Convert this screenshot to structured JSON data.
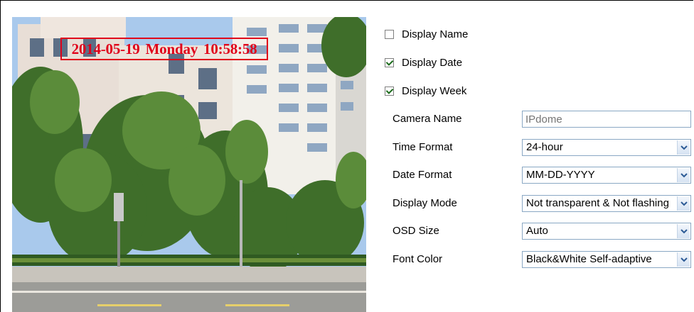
{
  "preview": {
    "osd_date": "2014-05-19",
    "osd_week": "Monday",
    "osd_time": "10:58:58"
  },
  "checkboxes": [
    {
      "label": "Display Name",
      "checked": false
    },
    {
      "label": "Display Date",
      "checked": true
    },
    {
      "label": "Display Week",
      "checked": true
    }
  ],
  "fields": {
    "camera_name": {
      "label": "Camera Name",
      "placeholder": "IPdome"
    },
    "time_format": {
      "label": "Time Format",
      "value": "24-hour"
    },
    "date_format": {
      "label": "Date Format",
      "value": "MM-DD-YYYY"
    },
    "display_mode": {
      "label": "Display Mode",
      "value": "Not transparent & Not flashing"
    },
    "osd_size": {
      "label": "OSD Size",
      "value": "Auto"
    },
    "font_color": {
      "label": "Font Color",
      "value": "Black&White Self-adaptive"
    }
  },
  "icons": {
    "dropdown": "chevron-down-icon",
    "check": "checkmark-icon"
  },
  "colors": {
    "osd_red": "#e0001a",
    "dropdown_arrow": "#2d5b96",
    "input_border": "#8aa8c4"
  }
}
